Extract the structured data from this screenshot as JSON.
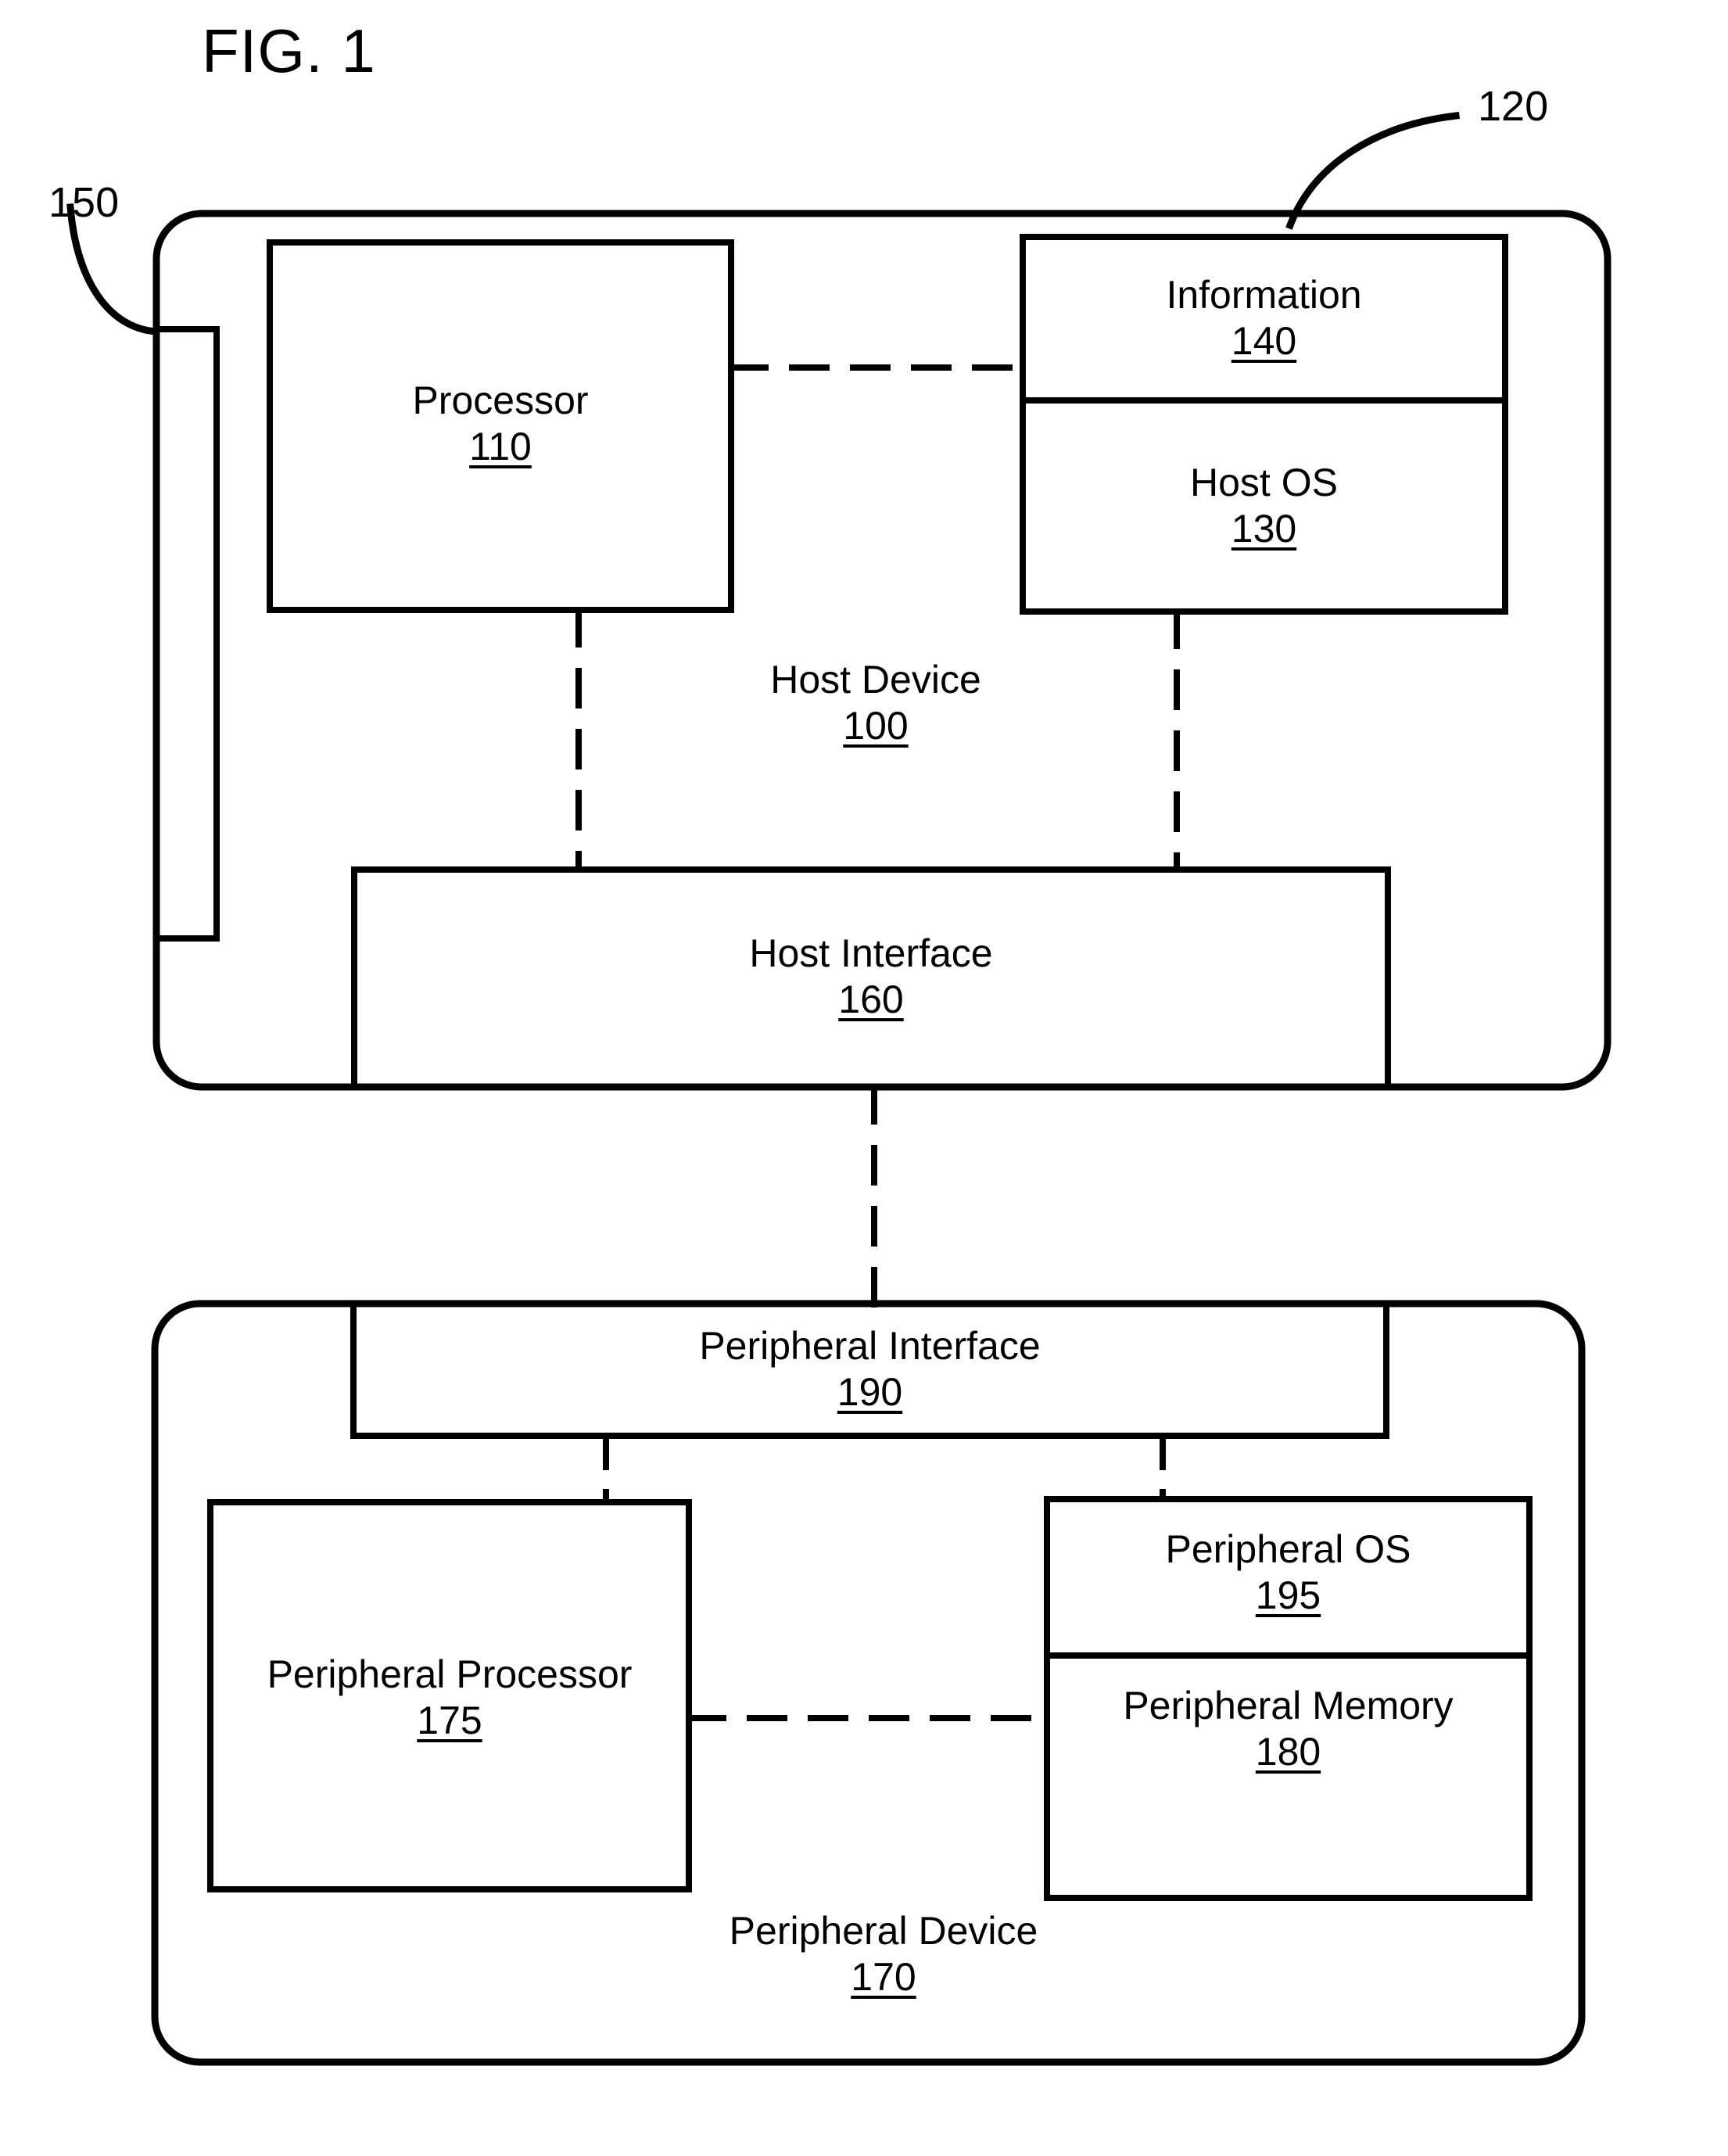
{
  "figure": {
    "title": "FIG. 1",
    "type": "patent-block-diagram"
  },
  "callouts": {
    "host_device_enclosure_ref": "120",
    "port_ref": "150"
  },
  "host_device": {
    "name": "Host Device",
    "ref": "100",
    "blocks": [
      {
        "id": "processor",
        "name": "Processor",
        "ref": "110"
      },
      {
        "id": "information",
        "name": "Information",
        "ref": "140"
      },
      {
        "id": "host_os",
        "name": "Host OS",
        "ref": "130"
      },
      {
        "id": "host_interface",
        "name": "Host Interface",
        "ref": "160"
      }
    ]
  },
  "peripheral_device": {
    "name": "Peripheral Device",
    "ref": "170",
    "blocks": [
      {
        "id": "peripheral_interface",
        "name": "Peripheral Interface",
        "ref": "190"
      },
      {
        "id": "peripheral_processor",
        "name": "Peripheral Processor",
        "ref": "175"
      },
      {
        "id": "peripheral_os",
        "name": "Peripheral OS",
        "ref": "195"
      },
      {
        "id": "peripheral_memory",
        "name": "Peripheral Memory",
        "ref": "180"
      }
    ]
  },
  "style": {
    "stroke": "#000000",
    "background": "#ffffff"
  }
}
